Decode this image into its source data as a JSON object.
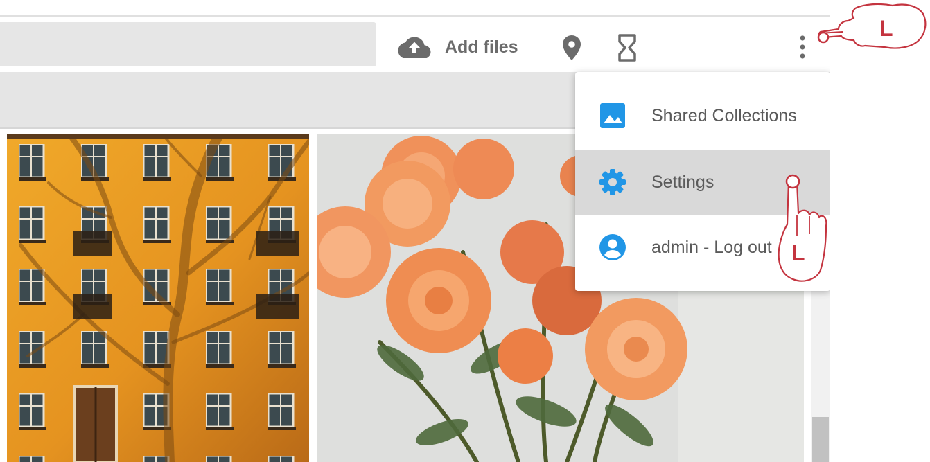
{
  "toolbar": {
    "add_files_label": "Add files",
    "icons": {
      "upload": "cloud-upload-icon",
      "location": "map-pin-icon",
      "timeline": "hourglass-icon",
      "more": "more-vertical-icon"
    }
  },
  "menu": {
    "items": [
      {
        "label": "Shared Collections",
        "icon": "image-icon",
        "active": false
      },
      {
        "label": "Settings",
        "icon": "gear-icon",
        "active": true
      },
      {
        "label": "admin - Log out",
        "icon": "account-circle-icon",
        "active": false
      }
    ]
  },
  "annotations": [
    {
      "label": "L",
      "target": "more-options-button",
      "color": "#c4343f"
    },
    {
      "label": "L",
      "target": "menu-item-settings",
      "color": "#c4343f"
    }
  ],
  "colors": {
    "accent": "#2196e6",
    "annotation": "#c4343f",
    "toolbar_text": "#6b6b6b",
    "menu_text": "#5a5a5a",
    "menu_active_bg": "#d9d9d9"
  }
}
